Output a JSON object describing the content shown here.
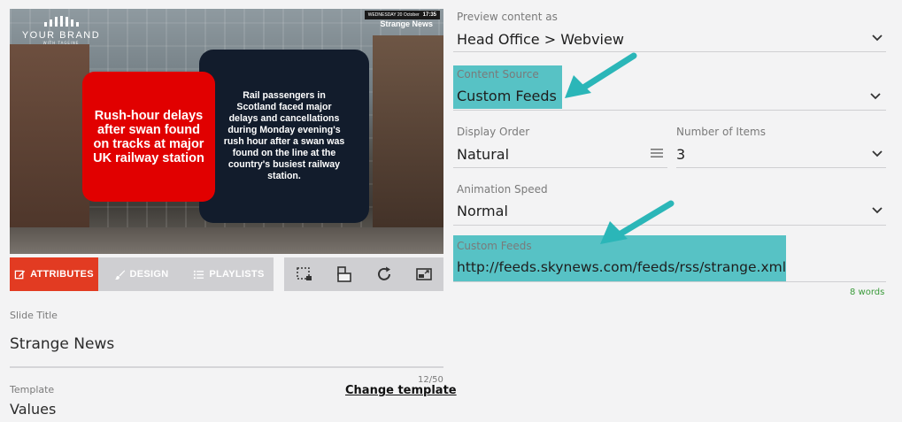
{
  "preview": {
    "brand_name": "YOUR BRAND",
    "brand_tagline": "WITH TAGLINE",
    "date": "WEDNESDAY 20 October",
    "time": "17:35",
    "feed_title": "Strange News",
    "headline": "Rush-hour delays after swan found on tracks at major UK railway station",
    "body": "Rail passengers in Scotland faced major delays and cancellations during Monday evening's rush hour after a swan was found on the line at the country's busiest railway station."
  },
  "tabs": [
    {
      "label": "ATTRIBUTES",
      "icon": "edit-icon"
    },
    {
      "label": "DESIGN",
      "icon": "brush-icon"
    },
    {
      "label": "PLAYLISTS",
      "icon": "list-icon"
    }
  ],
  "tools": [
    "crop-frame-icon",
    "layers-icon",
    "refresh-icon",
    "resize-icon"
  ],
  "left_form": {
    "slide_title_label": "Slide Title",
    "slide_title_value": "Strange News",
    "counter": "12/50",
    "template_label": "Template",
    "template_value": "Values",
    "change_template": "Change template"
  },
  "right_form": {
    "preview_label": "Preview content as",
    "preview_value": "Head Office > Webview",
    "content_source_label": "Content Source",
    "content_source_value": "Custom Feeds",
    "display_order_label": "Display Order",
    "display_order_value": "Natural",
    "items_label": "Number of Items",
    "items_value": "3",
    "animation_label": "Animation Speed",
    "animation_value": "Normal",
    "feeds_label": "Custom Feeds",
    "feeds_value": "http://feeds.skynews.com/feeds/rss/strange.xml",
    "words": "8 words"
  },
  "colors": {
    "accent": "#e23b22",
    "highlight": "#57c2c5",
    "arrow": "#2bb6b8",
    "red_box": "#e10000",
    "navy_box": "#121c2c"
  }
}
